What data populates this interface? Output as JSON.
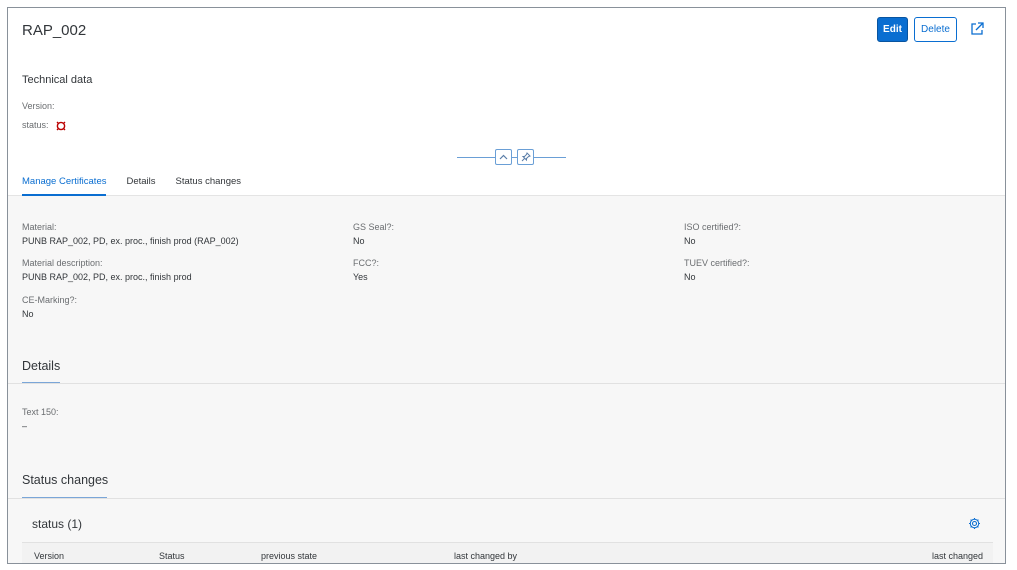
{
  "header": {
    "title": "RAP_002",
    "edit_label": "Edit",
    "delete_label": "Delete"
  },
  "technical_data": {
    "heading": "Technical data",
    "version_label": "Version:",
    "status_label": "status:"
  },
  "tabs": [
    {
      "label": "Manage Certificates",
      "active": true
    },
    {
      "label": "Details",
      "active": false
    },
    {
      "label": "Status changes",
      "active": false
    }
  ],
  "certificates": {
    "material_label": "Material:",
    "material_value": "PUNB RAP_002, PD, ex. proc., finish prod (RAP_002)",
    "material_desc_label": "Material description:",
    "material_desc_value": "PUNB RAP_002, PD, ex. proc., finish prod",
    "ce_label": "CE-Marking?:",
    "ce_value": "No",
    "gs_label": "GS Seal?:",
    "gs_value": "No",
    "fcc_label": "FCC?:",
    "fcc_value": "Yes",
    "iso_label": "ISO certified?:",
    "iso_value": "No",
    "tuev_label": "TUEV certified?:",
    "tuev_value": "No"
  },
  "details": {
    "title": "Details",
    "text150_label": "Text 150:",
    "text150_value": "–"
  },
  "status_changes": {
    "title": "Status changes",
    "table_title": "status (1)",
    "columns": [
      "Version",
      "Status",
      "previous state",
      "last changed by",
      "last changed"
    ]
  },
  "colors": {
    "accent": "#0a6ed1",
    "status_negative": "#bb0000"
  },
  "icons": {
    "share": "share-icon",
    "status": "status-negative-icon",
    "collapse": "chevron-up-icon",
    "pin": "pin-icon",
    "settings": "gear-icon"
  }
}
